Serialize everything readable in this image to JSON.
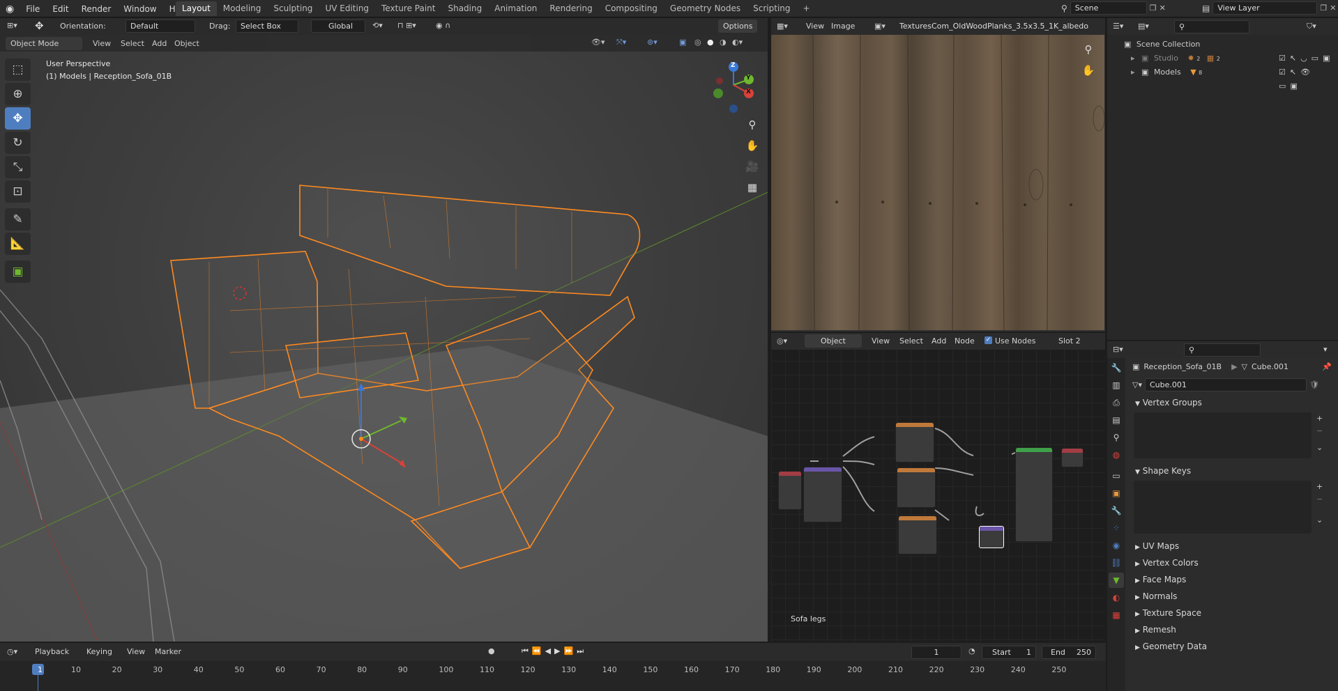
{
  "topbar": {
    "menus": [
      "File",
      "Edit",
      "Render",
      "Window",
      "Help"
    ],
    "workspaces": [
      "Layout",
      "Modeling",
      "Sculpting",
      "UV Editing",
      "Texture Paint",
      "Shading",
      "Animation",
      "Rendering",
      "Compositing",
      "Geometry Nodes",
      "Scripting"
    ],
    "active_workspace": "Layout",
    "add_tab": "+",
    "scene": "Scene",
    "view_layer": "View Layer"
  },
  "viewport": {
    "orientation_label": "Orientation:",
    "orientation_value": "Default",
    "drag_label": "Drag:",
    "drag_value": "Select Box",
    "transform_space": "Global",
    "options": "Options",
    "mode": "Object Mode",
    "menus": [
      "View",
      "Select",
      "Add",
      "Object"
    ],
    "perspective": "User Perspective",
    "object_info": "(1) Models | Reception_Sofa_01B",
    "gizmo": {
      "z": "Z",
      "y": "Y",
      "x": "X"
    }
  },
  "image_editor": {
    "menus": [
      "View",
      "Image"
    ],
    "image_name": "TexturesCom_OldWoodPlanks_3.5x3.5_1K_albedo.tif"
  },
  "node_editor": {
    "object_mode": "Object",
    "menus": [
      "View",
      "Select",
      "Add",
      "Node"
    ],
    "use_nodes": "Use Nodes",
    "slot": "Slot 2",
    "material_name": "Sofa legs"
  },
  "outliner": {
    "root": "Scene Collection",
    "items": [
      {
        "label": "Studio",
        "count_a": "2",
        "count_b": "2"
      },
      {
        "label": "Models",
        "count": "8"
      }
    ]
  },
  "properties": {
    "object_name": "Reception_Sofa_01B",
    "mesh_name": "Cube.001",
    "mesh_field": "Cube.001",
    "sections": [
      "Vertex Groups",
      "Shape Keys",
      "UV Maps",
      "Vertex Colors",
      "Face Maps",
      "Normals",
      "Texture Space",
      "Remesh",
      "Geometry Data"
    ]
  },
  "timeline": {
    "menus": [
      "Playback",
      "Keying",
      "View",
      "Marker"
    ],
    "current_frame": "1",
    "start_label": "Start",
    "start": "1",
    "end_label": "End",
    "end": "250",
    "ticks": [
      "1",
      "10",
      "20",
      "30",
      "40",
      "50",
      "60",
      "70",
      "80",
      "90",
      "100",
      "110",
      "120",
      "130",
      "140",
      "150",
      "160",
      "170",
      "180",
      "190",
      "200",
      "210",
      "220",
      "230",
      "240",
      "250"
    ]
  },
  "colors": {
    "accent": "#4f7ec0",
    "selection": "#ff8a1f",
    "workspace_active": "#3d3d3d"
  }
}
